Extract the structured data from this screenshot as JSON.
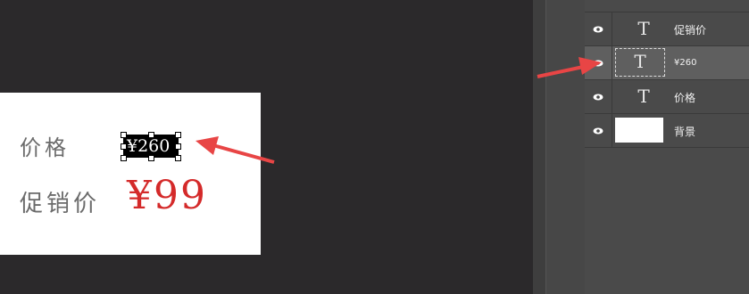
{
  "canvas": {
    "price_label": "价格",
    "price_value": "¥260",
    "promo_label": "促销价",
    "promo_value": "¥99"
  },
  "layers_panel": {
    "layers": [
      {
        "name": "促销价",
        "type": "text",
        "thumb": "T",
        "selected": false
      },
      {
        "name": "¥260",
        "type": "text",
        "thumb": "T",
        "selected": true
      },
      {
        "name": "价格",
        "type": "text",
        "thumb": "T",
        "selected": false
      },
      {
        "name": "背景",
        "type": "background",
        "thumb": "",
        "selected": false
      }
    ]
  },
  "colors": {
    "workspace_bg": "#2b292b",
    "promo_red": "#d42a2a",
    "arrow_red": "#e84545"
  }
}
